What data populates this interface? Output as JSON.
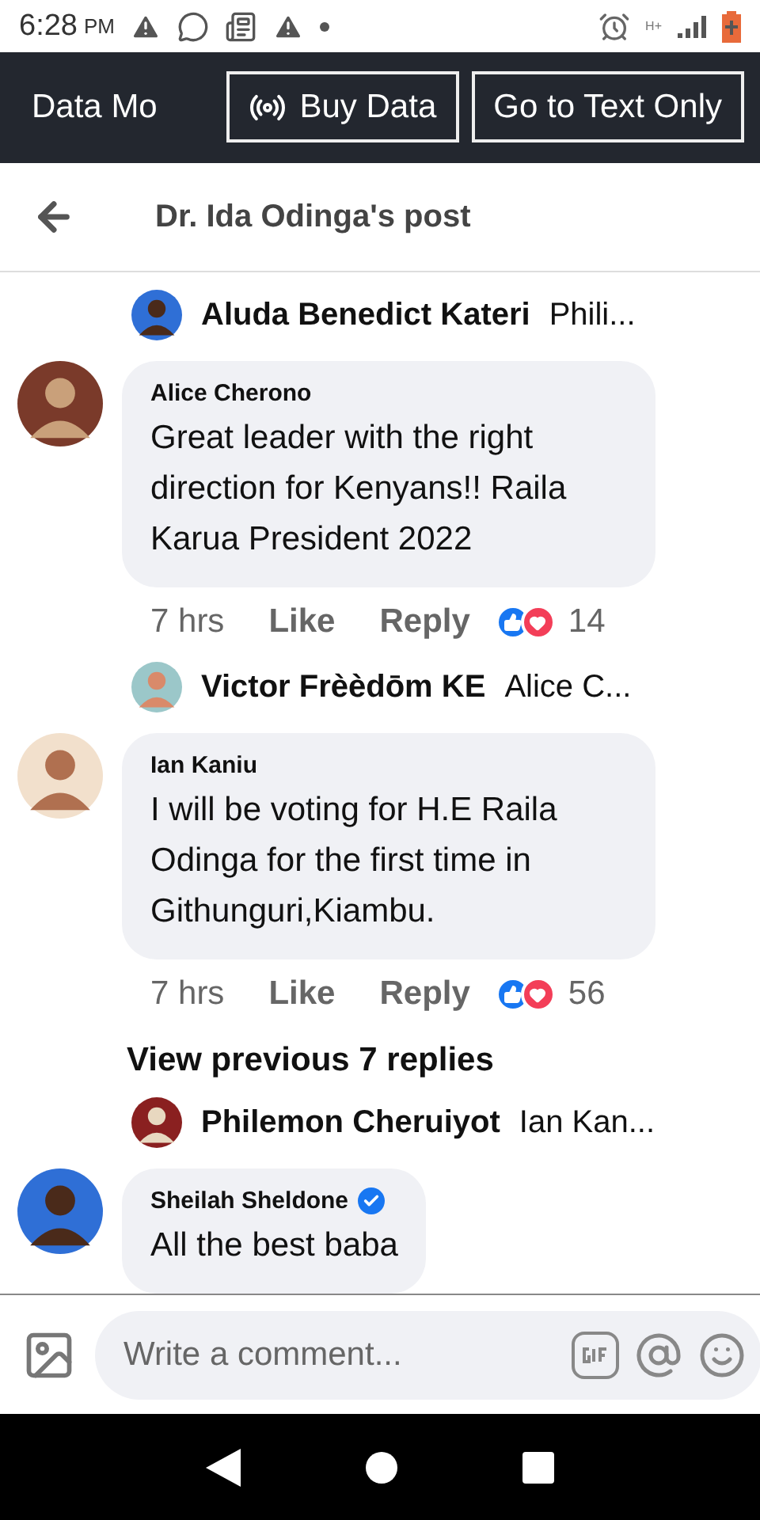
{
  "status_bar": {
    "time": "6:28",
    "period": "PM",
    "network": "H+"
  },
  "data_bar": {
    "label": "Data Mo",
    "buttons": [
      {
        "label": "Buy Data",
        "kind": "buy"
      },
      {
        "label": "Go to Text Only",
        "kind": "plain"
      }
    ]
  },
  "header": {
    "title": "Dr. Ida Odinga's post"
  },
  "feed": [
    {
      "kind": "preview",
      "name": "Aluda Benedict Kateri",
      "snippet": "Phili..."
    },
    {
      "kind": "comment",
      "name": "Alice Cherono",
      "verified": false,
      "text": "Great leader with the right direction for Kenyans!! Raila Karua President 2022",
      "time": "7 hrs",
      "like": "Like",
      "reply": "Reply",
      "count": "14"
    },
    {
      "kind": "preview",
      "name": "Victor Frèèdōm KE",
      "snippet": "Alice C..."
    },
    {
      "kind": "comment",
      "name": "Ian Kaniu",
      "verified": false,
      "text": "I will be voting for H.E Raila Odinga for the first time in Githunguri,Kiambu.",
      "time": "7 hrs",
      "like": "Like",
      "reply": "Reply",
      "count": "56"
    },
    {
      "kind": "more",
      "label": "View previous 7 replies"
    },
    {
      "kind": "preview",
      "name": "Philemon Cheruiyot",
      "snippet": "Ian Kan..."
    },
    {
      "kind": "comment",
      "name": "Sheilah Sheldone",
      "verified": true,
      "text": "All the best baba"
    }
  ],
  "composer": {
    "placeholder": "Write a comment..."
  }
}
